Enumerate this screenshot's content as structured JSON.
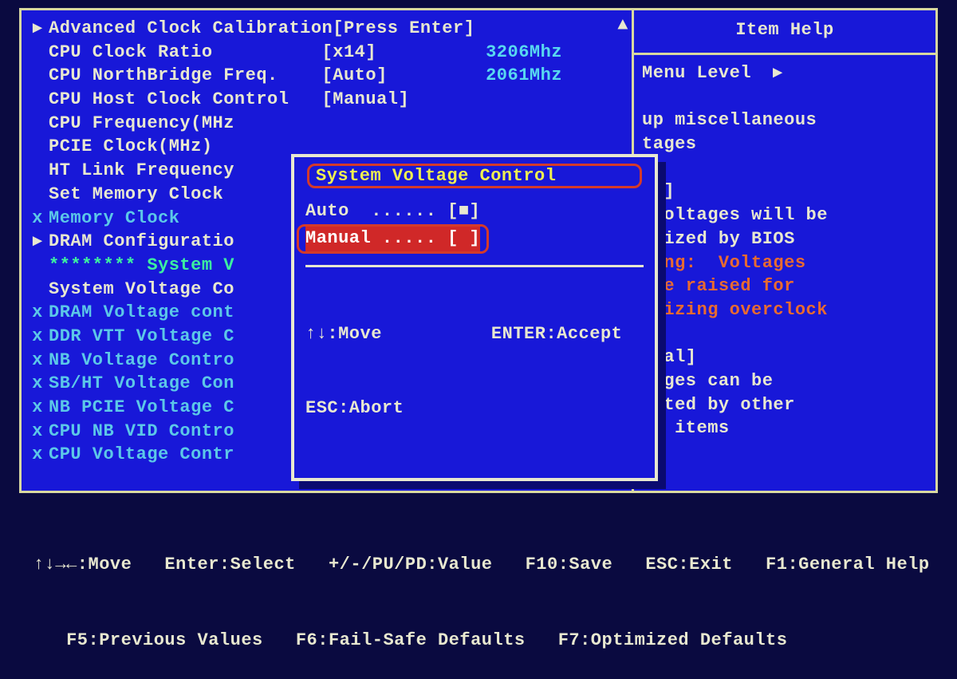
{
  "help": {
    "title": "Item Help",
    "menu_level": "Menu Level",
    "lines": [
      "",
      "up miscellaneous",
      "tages",
      "",
      "to]",
      " voltages will be",
      "imized by BIOS"
    ],
    "warn_lines": [
      "ning:  Voltages",
      " be raised for",
      "imizing overclock"
    ],
    "lines2": [
      "",
      "nual]",
      "tages can be",
      "usted by other",
      "up items"
    ]
  },
  "items": [
    {
      "marker": "▸",
      "label": "Advanced Clock Calibration",
      "value": "[Press Enter]",
      "cls": "label"
    },
    {
      "marker": " ",
      "label": "CPU Clock Ratio          ",
      "value": "[x14]          ",
      "extra": "3206Mhz",
      "cls": "label"
    },
    {
      "marker": " ",
      "label": "CPU NorthBridge Freq.    ",
      "value": "[Auto]         ",
      "extra": "2061Mhz",
      "cls": "label"
    },
    {
      "marker": " ",
      "label": "CPU Host Clock Control   ",
      "value": "[Manual]",
      "cls": "label"
    },
    {
      "marker": " ",
      "label": "CPU Frequency(MHz",
      "cls": "label"
    },
    {
      "marker": " ",
      "label": "PCIE Clock(MHz)  ",
      "cls": "label"
    },
    {
      "marker": " ",
      "label": "HT Link Frequency",
      "cls": "label"
    },
    {
      "marker": " ",
      "label": "Set Memory Clock ",
      "cls": "label"
    },
    {
      "marker": "x",
      "label": "Memory Clock     ",
      "cls": "label disabled",
      "mcls": "x"
    },
    {
      "marker": "▸",
      "label": "DRAM Configuratio",
      "cls": "label"
    },
    {
      "marker": " ",
      "label": "******** System V",
      "cls": "green"
    },
    {
      "marker": " ",
      "label": "System Voltage Co",
      "cls": "label"
    },
    {
      "marker": "x",
      "label": "DRAM Voltage cont",
      "cls": "label disabled",
      "mcls": "x"
    },
    {
      "marker": "x",
      "label": "DDR VTT Voltage C",
      "cls": "label disabled",
      "mcls": "x"
    },
    {
      "marker": "x",
      "label": "NB Voltage Contro",
      "cls": "label disabled",
      "mcls": "x"
    },
    {
      "marker": "x",
      "label": "SB/HT Voltage Con",
      "cls": "label disabled",
      "mcls": "x"
    },
    {
      "marker": "x",
      "label": "NB PCIE Voltage C",
      "cls": "label disabled",
      "mcls": "x"
    },
    {
      "marker": "x",
      "label": "CPU NB VID Contro",
      "cls": "label disabled",
      "mcls": "x"
    },
    {
      "marker": "x",
      "label": "CPU Voltage Contr",
      "cls": "label disabled",
      "mcls": "x"
    }
  ],
  "popup": {
    "title": "System Voltage Control",
    "options": [
      {
        "text": "Auto  ...... [■]",
        "selected": false
      },
      {
        "text": "Manual ..... [ ]",
        "selected": true
      }
    ],
    "footer1": "↑↓:Move          ENTER:Accept",
    "footer2": "ESC:Abort"
  },
  "footer": {
    "l1": "↑↓→←:Move   Enter:Select   +/-/PU/PD:Value   F10:Save   ESC:Exit   F1:General Help",
    "l2": "   F5:Previous Values   F6:Fail-Safe Defaults   F7:Optimized Defaults"
  }
}
